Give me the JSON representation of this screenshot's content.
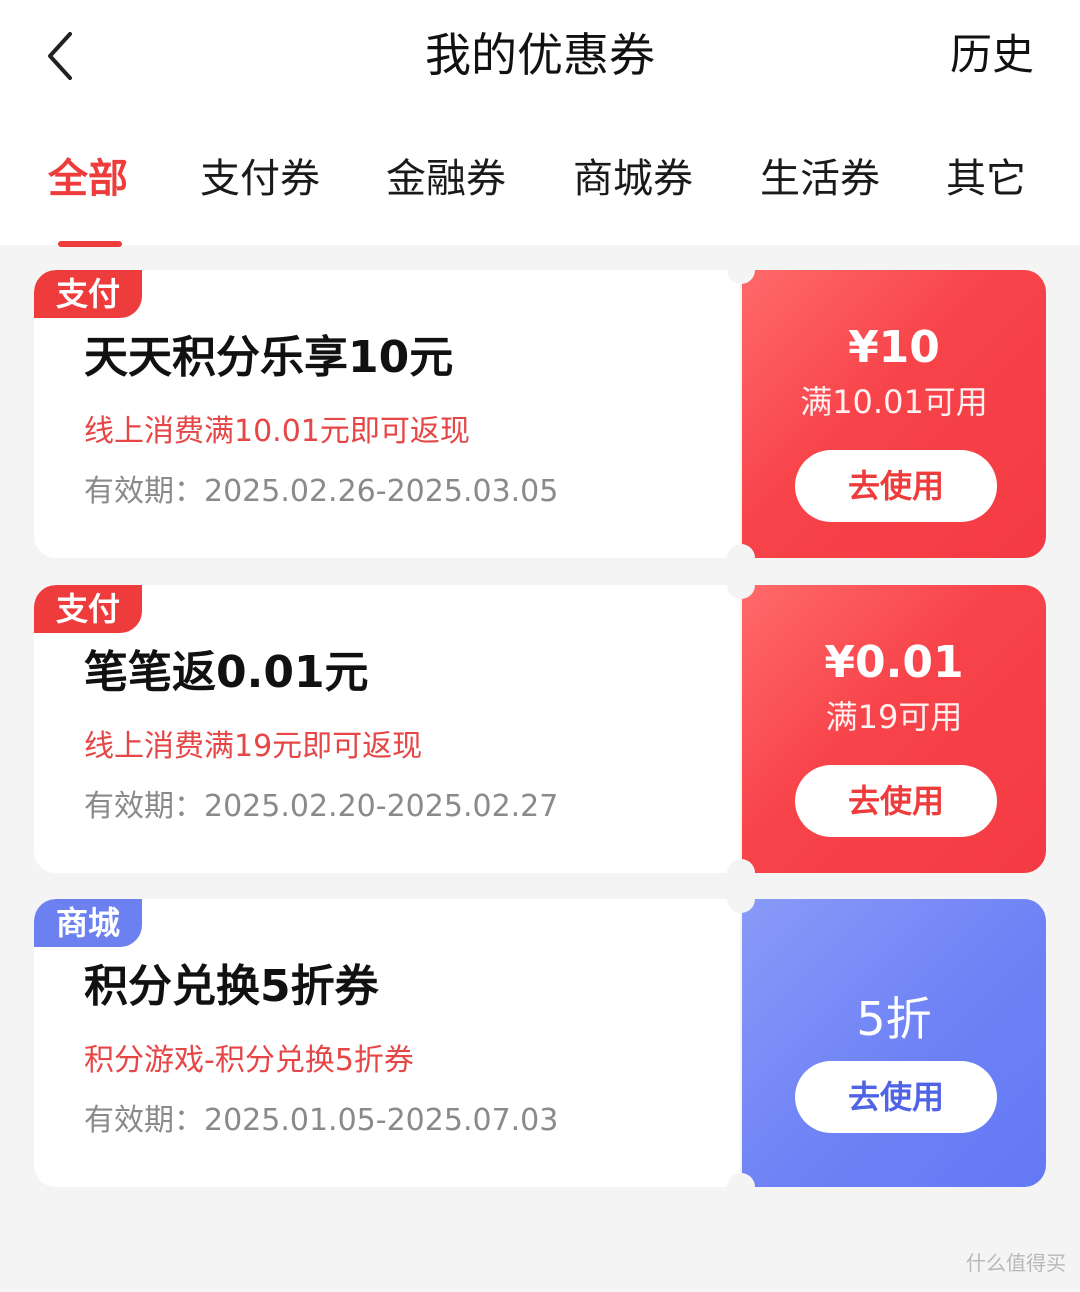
{
  "header": {
    "title": "我的优惠券",
    "history_label": "历史"
  },
  "tabs": [
    {
      "label": "全部",
      "active": true
    },
    {
      "label": "支付券",
      "active": false
    },
    {
      "label": "金融券",
      "active": false
    },
    {
      "label": "商城券",
      "active": false
    },
    {
      "label": "生活券",
      "active": false
    },
    {
      "label": "其它",
      "active": false
    }
  ],
  "coupons": [
    {
      "tag": "支付",
      "title": "天天积分乐享10元",
      "desc": "线上消费满10.01元即可返现",
      "validity": "有效期：2025.02.26-2025.03.05",
      "amount": "¥10",
      "condition": "满10.01可用",
      "button": "去使用",
      "theme": "red"
    },
    {
      "tag": "支付",
      "title": "笔笔返0.01元",
      "desc": "线上消费满19元即可返现",
      "validity": "有效期：2025.02.20-2025.02.27",
      "amount": "¥0.01",
      "condition": "满19可用",
      "button": "去使用",
      "theme": "red"
    },
    {
      "tag": "商城",
      "title": "积分兑换5折券",
      "desc": "积分游戏-积分兑换5折券",
      "validity": "有效期：2025.01.05-2025.07.03",
      "amount": "5折",
      "button": "去使用",
      "theme": "blue"
    }
  ],
  "colors": {
    "accent_red": "#ee3b3b",
    "accent_blue": "#6c80f0"
  },
  "watermark": "什么值得买"
}
